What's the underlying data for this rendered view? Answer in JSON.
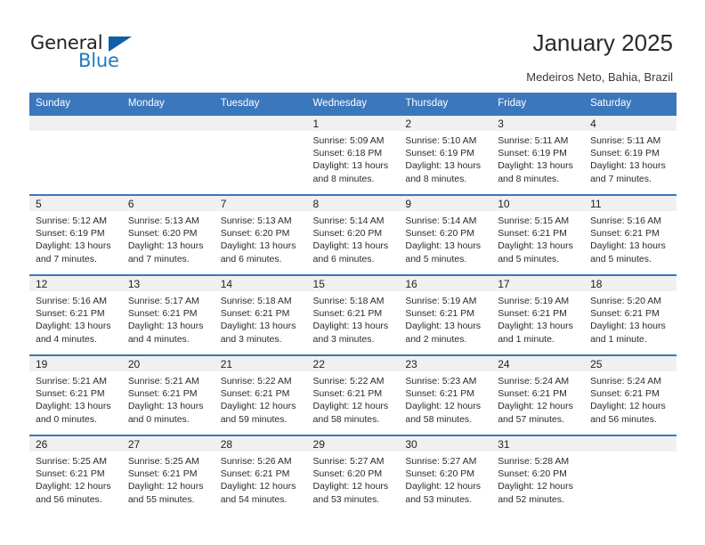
{
  "brand": {
    "name_part1": "General",
    "name_part2": "Blue",
    "triangle_color": "#105ea5",
    "blue_color": "#1f7bc1"
  },
  "header": {
    "title": "January 2025",
    "subtitle": "Medeiros Neto, Bahia, Brazil"
  },
  "theme": {
    "header_bg": "#3b77bc",
    "daynum_bg": "#f0f0f0",
    "cell_bg": "#ffffff"
  },
  "weekday_headers": [
    "Sunday",
    "Monday",
    "Tuesday",
    "Wednesday",
    "Thursday",
    "Friday",
    "Saturday"
  ],
  "weeks": [
    [
      {
        "day": "",
        "sunrise": "",
        "sunset": "",
        "daylight": ""
      },
      {
        "day": "",
        "sunrise": "",
        "sunset": "",
        "daylight": ""
      },
      {
        "day": "",
        "sunrise": "",
        "sunset": "",
        "daylight": ""
      },
      {
        "day": "1",
        "sunrise": "Sunrise: 5:09 AM",
        "sunset": "Sunset: 6:18 PM",
        "daylight": "Daylight: 13 hours and 8 minutes."
      },
      {
        "day": "2",
        "sunrise": "Sunrise: 5:10 AM",
        "sunset": "Sunset: 6:19 PM",
        "daylight": "Daylight: 13 hours and 8 minutes."
      },
      {
        "day": "3",
        "sunrise": "Sunrise: 5:11 AM",
        "sunset": "Sunset: 6:19 PM",
        "daylight": "Daylight: 13 hours and 8 minutes."
      },
      {
        "day": "4",
        "sunrise": "Sunrise: 5:11 AM",
        "sunset": "Sunset: 6:19 PM",
        "daylight": "Daylight: 13 hours and 7 minutes."
      }
    ],
    [
      {
        "day": "5",
        "sunrise": "Sunrise: 5:12 AM",
        "sunset": "Sunset: 6:19 PM",
        "daylight": "Daylight: 13 hours and 7 minutes."
      },
      {
        "day": "6",
        "sunrise": "Sunrise: 5:13 AM",
        "sunset": "Sunset: 6:20 PM",
        "daylight": "Daylight: 13 hours and 7 minutes."
      },
      {
        "day": "7",
        "sunrise": "Sunrise: 5:13 AM",
        "sunset": "Sunset: 6:20 PM",
        "daylight": "Daylight: 13 hours and 6 minutes."
      },
      {
        "day": "8",
        "sunrise": "Sunrise: 5:14 AM",
        "sunset": "Sunset: 6:20 PM",
        "daylight": "Daylight: 13 hours and 6 minutes."
      },
      {
        "day": "9",
        "sunrise": "Sunrise: 5:14 AM",
        "sunset": "Sunset: 6:20 PM",
        "daylight": "Daylight: 13 hours and 5 minutes."
      },
      {
        "day": "10",
        "sunrise": "Sunrise: 5:15 AM",
        "sunset": "Sunset: 6:21 PM",
        "daylight": "Daylight: 13 hours and 5 minutes."
      },
      {
        "day": "11",
        "sunrise": "Sunrise: 5:16 AM",
        "sunset": "Sunset: 6:21 PM",
        "daylight": "Daylight: 13 hours and 5 minutes."
      }
    ],
    [
      {
        "day": "12",
        "sunrise": "Sunrise: 5:16 AM",
        "sunset": "Sunset: 6:21 PM",
        "daylight": "Daylight: 13 hours and 4 minutes."
      },
      {
        "day": "13",
        "sunrise": "Sunrise: 5:17 AM",
        "sunset": "Sunset: 6:21 PM",
        "daylight": "Daylight: 13 hours and 4 minutes."
      },
      {
        "day": "14",
        "sunrise": "Sunrise: 5:18 AM",
        "sunset": "Sunset: 6:21 PM",
        "daylight": "Daylight: 13 hours and 3 minutes."
      },
      {
        "day": "15",
        "sunrise": "Sunrise: 5:18 AM",
        "sunset": "Sunset: 6:21 PM",
        "daylight": "Daylight: 13 hours and 3 minutes."
      },
      {
        "day": "16",
        "sunrise": "Sunrise: 5:19 AM",
        "sunset": "Sunset: 6:21 PM",
        "daylight": "Daylight: 13 hours and 2 minutes."
      },
      {
        "day": "17",
        "sunrise": "Sunrise: 5:19 AM",
        "sunset": "Sunset: 6:21 PM",
        "daylight": "Daylight: 13 hours and 1 minute."
      },
      {
        "day": "18",
        "sunrise": "Sunrise: 5:20 AM",
        "sunset": "Sunset: 6:21 PM",
        "daylight": "Daylight: 13 hours and 1 minute."
      }
    ],
    [
      {
        "day": "19",
        "sunrise": "Sunrise: 5:21 AM",
        "sunset": "Sunset: 6:21 PM",
        "daylight": "Daylight: 13 hours and 0 minutes."
      },
      {
        "day": "20",
        "sunrise": "Sunrise: 5:21 AM",
        "sunset": "Sunset: 6:21 PM",
        "daylight": "Daylight: 13 hours and 0 minutes."
      },
      {
        "day": "21",
        "sunrise": "Sunrise: 5:22 AM",
        "sunset": "Sunset: 6:21 PM",
        "daylight": "Daylight: 12 hours and 59 minutes."
      },
      {
        "day": "22",
        "sunrise": "Sunrise: 5:22 AM",
        "sunset": "Sunset: 6:21 PM",
        "daylight": "Daylight: 12 hours and 58 minutes."
      },
      {
        "day": "23",
        "sunrise": "Sunrise: 5:23 AM",
        "sunset": "Sunset: 6:21 PM",
        "daylight": "Daylight: 12 hours and 58 minutes."
      },
      {
        "day": "24",
        "sunrise": "Sunrise: 5:24 AM",
        "sunset": "Sunset: 6:21 PM",
        "daylight": "Daylight: 12 hours and 57 minutes."
      },
      {
        "day": "25",
        "sunrise": "Sunrise: 5:24 AM",
        "sunset": "Sunset: 6:21 PM",
        "daylight": "Daylight: 12 hours and 56 minutes."
      }
    ],
    [
      {
        "day": "26",
        "sunrise": "Sunrise: 5:25 AM",
        "sunset": "Sunset: 6:21 PM",
        "daylight": "Daylight: 12 hours and 56 minutes."
      },
      {
        "day": "27",
        "sunrise": "Sunrise: 5:25 AM",
        "sunset": "Sunset: 6:21 PM",
        "daylight": "Daylight: 12 hours and 55 minutes."
      },
      {
        "day": "28",
        "sunrise": "Sunrise: 5:26 AM",
        "sunset": "Sunset: 6:21 PM",
        "daylight": "Daylight: 12 hours and 54 minutes."
      },
      {
        "day": "29",
        "sunrise": "Sunrise: 5:27 AM",
        "sunset": "Sunset: 6:20 PM",
        "daylight": "Daylight: 12 hours and 53 minutes."
      },
      {
        "day": "30",
        "sunrise": "Sunrise: 5:27 AM",
        "sunset": "Sunset: 6:20 PM",
        "daylight": "Daylight: 12 hours and 53 minutes."
      },
      {
        "day": "31",
        "sunrise": "Sunrise: 5:28 AM",
        "sunset": "Sunset: 6:20 PM",
        "daylight": "Daylight: 12 hours and 52 minutes."
      },
      {
        "day": "",
        "sunrise": "",
        "sunset": "",
        "daylight": ""
      }
    ]
  ]
}
